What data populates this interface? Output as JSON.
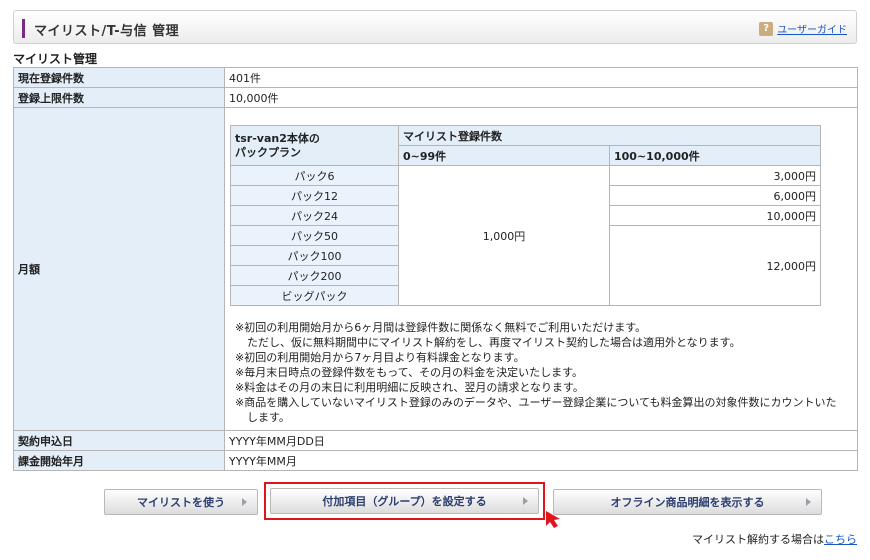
{
  "header": {
    "title": "マイリスト/T-与信 管理",
    "help_icon_glyph": "?",
    "guide_link": "ユーザーガイド"
  },
  "section_title": "マイリスト管理",
  "rows": {
    "current_count_label": "現在登録件数",
    "current_count_value": "401件",
    "limit_label": "登録上限件数",
    "limit_value": "10,000件",
    "monthly_label": "月額",
    "contract_label": "契約申込日",
    "contract_value": "YYYY年MM月DD日",
    "billing_label": "課金開始年月",
    "billing_value": "YYYY年MM月"
  },
  "plan_table": {
    "plan_header_line1": "tsr-van2本体の",
    "plan_header_line2": "パックプラン",
    "count_header": "マイリスト登録件数",
    "range_low": "0~99件",
    "range_high": "100~10,000件",
    "low_price": "1,000円",
    "packs": [
      "パック6",
      "パック12",
      "パック24",
      "パック50",
      "パック100",
      "パック200",
      "ビッグパック"
    ],
    "high_prices": [
      "3,000円",
      "6,000円",
      "10,000円",
      "12,000円"
    ]
  },
  "notes": {
    "n1": "※初回の利用開始月から6ヶ月間は登録件数に関係なく無料でご利用いただけます。",
    "n1b": "ただし、仮に無料期間中にマイリスト解約をし、再度マイリスト契約した場合は適用外となります。",
    "n2": "※初回の利用開始月から7ヶ月目より有料課金となります。",
    "n3": "※毎月末日時点の登録件数をもって、その月の料金を決定いたします。",
    "n4": "※料金はその月の末日に利用明細に反映され、翌月の請求となります。",
    "n5": "※商品を購入していないマイリスト登録のみのデータや、ユーザー登録企業についても料金算出の対象件数にカウントいたします。"
  },
  "buttons": {
    "use_mylist": "マイリストを使う",
    "set_group": "付加項目（グループ）を設定する",
    "offline_detail": "オフライン商品明細を表示する"
  },
  "footer": {
    "cancel_text": "マイリスト解約する場合は",
    "cancel_link": "こちら"
  },
  "colors": {
    "accent": "#7a2b86",
    "header_cell": "#e4eef8",
    "highlight": "#e0141b",
    "link": "#1a55c8"
  }
}
